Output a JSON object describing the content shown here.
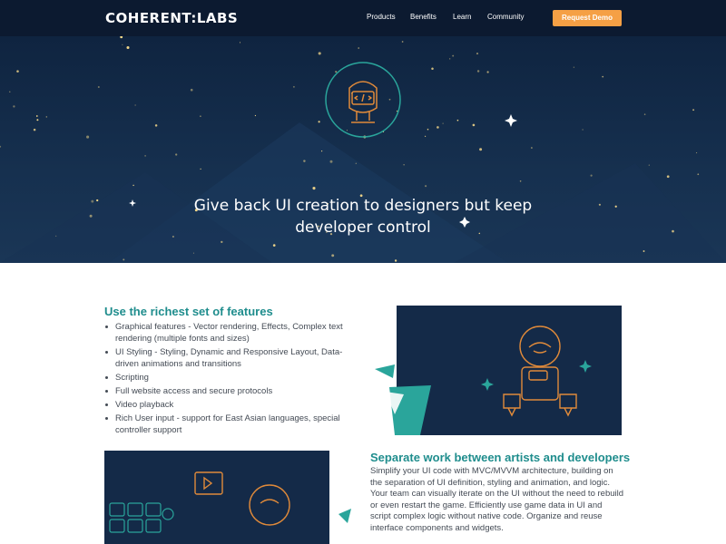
{
  "nav": {
    "logo": "COHERENT:LABS",
    "links": [
      "Products",
      "Benefits",
      "Learn",
      "Community"
    ],
    "cta": "Request Demo"
  },
  "hero": {
    "title": "Give back UI creation to designers but keep developer control",
    "icon": "developer-avatar-icon"
  },
  "features": {
    "title": "Use the richest set of features",
    "items": [
      "Graphical features - Vector rendering, Effects, Complex text rendering (multiple fonts and sizes)",
      "UI Styling - Styling, Dynamic and Responsive Layout, Data-driven animations and transitions",
      "Scripting",
      "Full website access and secure protocols",
      "Video playback",
      "Rich User input - support for East Asian languages, special controller support"
    ]
  },
  "separate": {
    "title": "Separate work between artists and developers",
    "body": "Simplify your UI code with MVC/MVVM architecture, building on the separation of UI definition, styling and animation, and logic. Your team can visually iterate on the UI without the need to rebuild or even restart the game. Efficiently use game data in UI and script complex logic without native code. Organize and reuse interface components and widgets."
  },
  "colors": {
    "nav_bg": "#0c1a30",
    "hero_bg": "#142a48",
    "accent_orange": "#f5a045",
    "accent_teal": "#1f8d8d",
    "text": "#444b55"
  }
}
